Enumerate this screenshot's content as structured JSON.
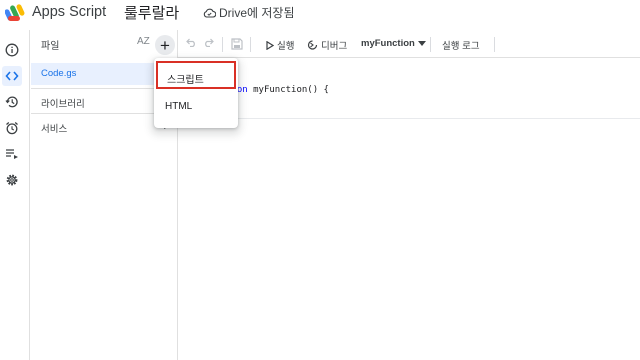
{
  "header": {
    "app_name": "Apps Script",
    "project_title": "룰루랄라",
    "save_status": "Drive에 저장됨"
  },
  "rail": {
    "items": [
      {
        "name": "info-icon",
        "active": false
      },
      {
        "name": "code-icon",
        "active": true
      },
      {
        "name": "history-icon",
        "active": false
      },
      {
        "name": "alarm-icon",
        "active": false
      },
      {
        "name": "executions-icon",
        "active": false
      },
      {
        "name": "settings-icon",
        "active": false
      }
    ]
  },
  "files": {
    "label": "파일",
    "sort_label": "AZ",
    "items": [
      {
        "name": "Code.gs",
        "selected": true
      }
    ],
    "sections": [
      {
        "label": "라이브러리"
      },
      {
        "label": "서비스"
      }
    ]
  },
  "toolbar": {
    "run_label": "실행",
    "debug_label": "디버그",
    "function_select": "myFunction",
    "log_label": "실행 로그"
  },
  "editor": {
    "code_keyword_fragment": "tion",
    "code_rest": " myFunction() {"
  },
  "menu": {
    "items": [
      {
        "label": "스크립트",
        "highlighted": true
      },
      {
        "label": "HTML",
        "highlighted": false
      }
    ]
  },
  "colors": {
    "accent": "#1a73e8",
    "selected_bg": "#e8f0fe",
    "highlight_border": "#d93025"
  }
}
